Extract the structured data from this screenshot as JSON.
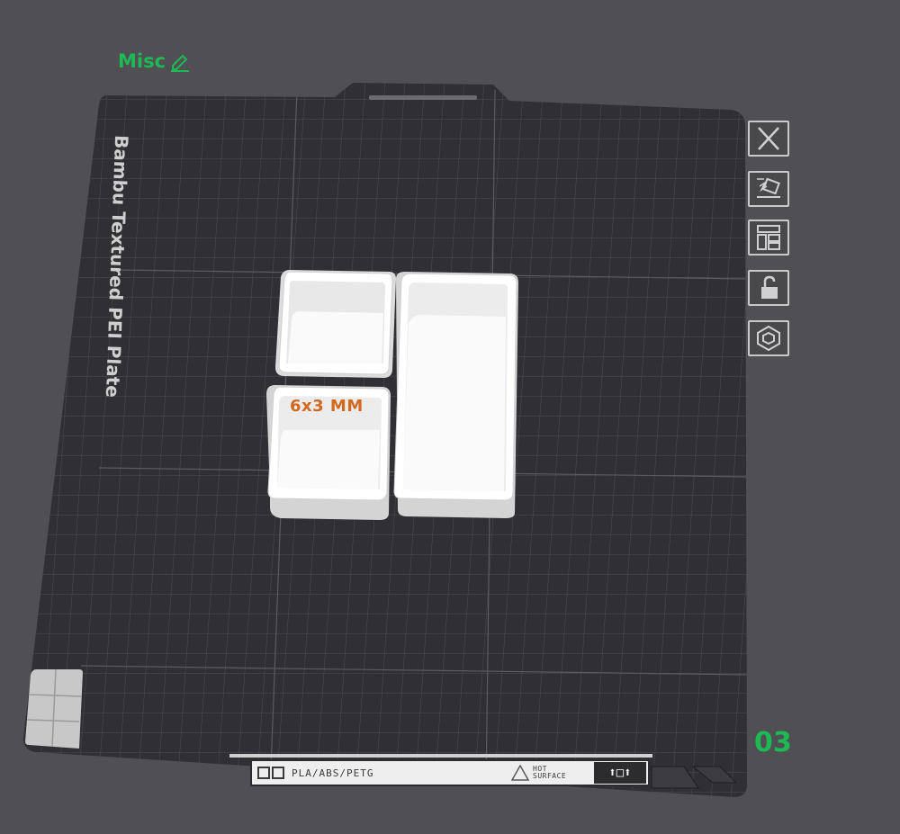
{
  "plate": {
    "name": "Misc",
    "number": "03",
    "brand": "Bambu Textured PEI Plate",
    "material": "PLA/ABS/PETG",
    "hot_surface": "HOT SURFACE",
    "object_label": "6x3 MM"
  },
  "toolbar": {
    "tools": [
      {
        "name": "delete-plate-button",
        "icon": "close-icon"
      },
      {
        "name": "auto-orient-button",
        "icon": "auto-orient-icon"
      },
      {
        "name": "arrange-button",
        "icon": "arrange-icon"
      },
      {
        "name": "lock-plate-button",
        "icon": "unlock-icon"
      },
      {
        "name": "plate-settings-button",
        "icon": "hexagon-nut-icon"
      }
    ]
  },
  "colors": {
    "accent_green": "#1db954",
    "label_orange": "#d2691e",
    "plate_dark": "#2f2f33",
    "grid_line": "#4a4a4f",
    "object_white": "#f4f4f4"
  }
}
